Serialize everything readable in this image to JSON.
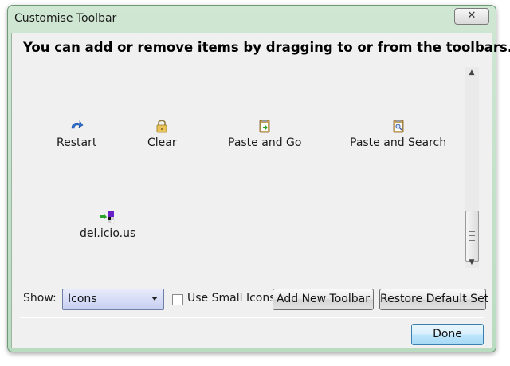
{
  "window": {
    "title": "Customise Toolbar",
    "close_glyph": "✕"
  },
  "heading": "You can add or remove items by dragging to or from the toolbars.",
  "palette": {
    "items": [
      {
        "label": "Restart",
        "icon": "restart-icon"
      },
      {
        "label": "Clear",
        "icon": "padlock-icon"
      },
      {
        "label": "Paste and Go",
        "icon": "paste-go-icon"
      },
      {
        "label": "Paste and Search",
        "icon": "paste-search-icon"
      },
      {
        "label": "del.icio.us",
        "icon": "delicious-icon"
      }
    ]
  },
  "controls": {
    "show_label": "Show:",
    "show_value": "Icons",
    "small_icons_label": "Use Small Icons",
    "small_icons_checked": false,
    "add_toolbar_label": "Add New Toolbar",
    "restore_label": "Restore Default Set",
    "done_label": "Done"
  },
  "colors": {
    "frame": "#b9dcc1",
    "primary_button": "#bee6fd"
  }
}
